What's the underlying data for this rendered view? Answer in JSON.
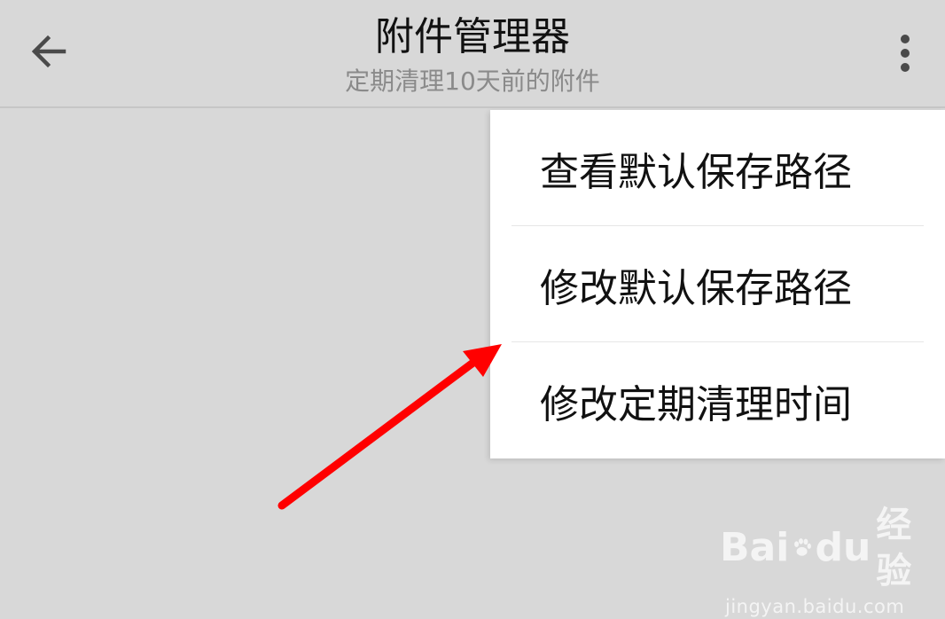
{
  "header": {
    "title": "附件管理器",
    "subtitle": "定期清理10天前的附件",
    "back_icon": "arrow-left-icon",
    "overflow_icon": "more-vertical-icon"
  },
  "menu": {
    "items": [
      {
        "label": "查看默认保存路径"
      },
      {
        "label": "修改默认保存路径"
      },
      {
        "label": "修改定期清理时间"
      }
    ]
  },
  "annotation": {
    "arrow_color": "#ff0000"
  },
  "watermark": {
    "brand_left": "Bai",
    "brand_right": "du",
    "brand_suffix": "经验",
    "url": "jingyan.baidu.com"
  },
  "colors": {
    "background": "#d8d8d8",
    "menu_background": "#ffffff",
    "title_text": "#111111",
    "subtitle_text": "#8a8a8a"
  }
}
